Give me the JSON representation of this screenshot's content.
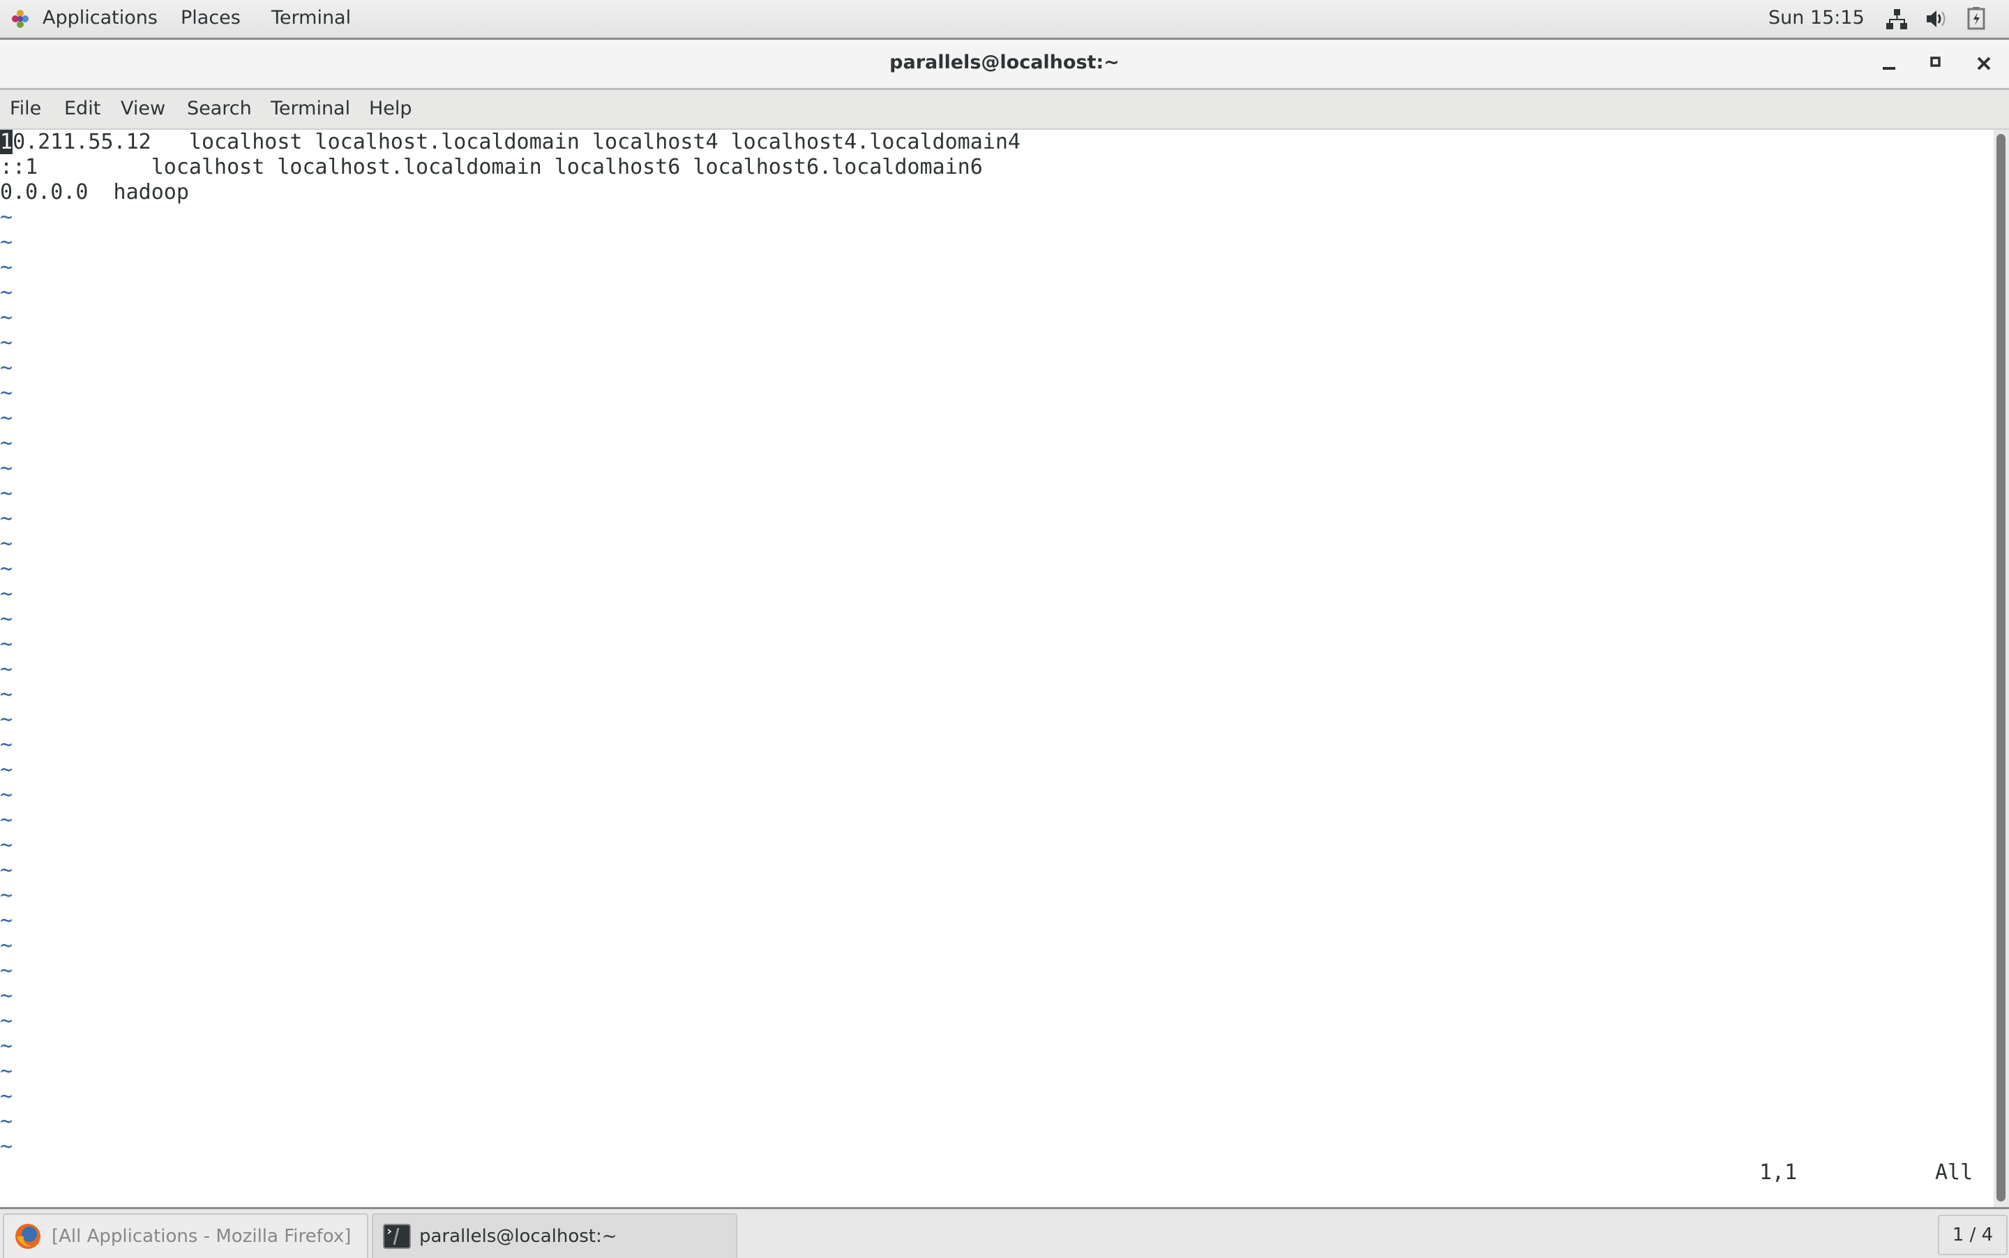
{
  "top_panel": {
    "applications": "Applications",
    "places": "Places",
    "terminal": "Terminal",
    "clock": "Sun 15:15",
    "icons": [
      "network-icon",
      "volume-icon",
      "battery-icon"
    ]
  },
  "window": {
    "title": "parallels@localhost:~",
    "menu": [
      "File",
      "Edit",
      "View",
      "Search",
      "Terminal",
      "Help"
    ]
  },
  "editor": {
    "cursor_char": "1",
    "lines": [
      "0.211.55.12   localhost localhost.localdomain localhost4 localhost4.localdomain4",
      "::1         localhost localhost.localdomain localhost6 localhost6.localdomain6",
      "0.0.0.0  hadoop"
    ],
    "empty_line_marker": "~",
    "empty_line_count": 38,
    "status_position": "1,1",
    "status_scroll": "All",
    "colors": {
      "tilde": "#3465a4",
      "text": "#2e3436"
    }
  },
  "taskbar": {
    "tasks": [
      {
        "label": "[All Applications - Mozilla Firefox]",
        "icon": "firefox-icon"
      },
      {
        "label": "parallels@localhost:~",
        "icon": "terminal-icon"
      }
    ],
    "workspace": "1 / 4"
  }
}
